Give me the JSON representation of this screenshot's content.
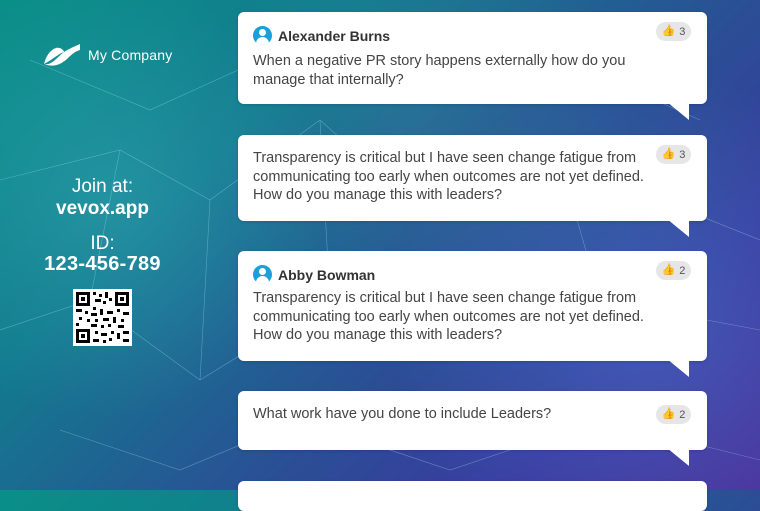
{
  "company": {
    "name": "My Company"
  },
  "join": {
    "label": "Join at:",
    "url": "vevox.app",
    "id_label": "ID:",
    "id_value": "123-456-789"
  },
  "questions": [
    {
      "author": "Alexander Burns",
      "text": "When a negative PR story happens externally how do you manage that internally?",
      "likes": "3"
    },
    {
      "author": "",
      "text": "Transparency is critical but I have seen change fatigue from communicating too early when outcomes are not yet defined. How do you manage this with leaders?",
      "likes": "3"
    },
    {
      "author": "Abby Bowman",
      "text": "Transparency is critical but I have seen change fatigue from communicating too early when outcomes are not yet defined. How do you manage this with leaders?",
      "likes": "2"
    },
    {
      "author": "",
      "text": "What work have you done to include Leaders?",
      "likes": "2"
    }
  ],
  "icons": {
    "avatar": "user-circle-icon",
    "like": "thumbs-up-icon",
    "qr": "qr-code-icon"
  },
  "colors": {
    "accent": "#1a9fd9"
  }
}
